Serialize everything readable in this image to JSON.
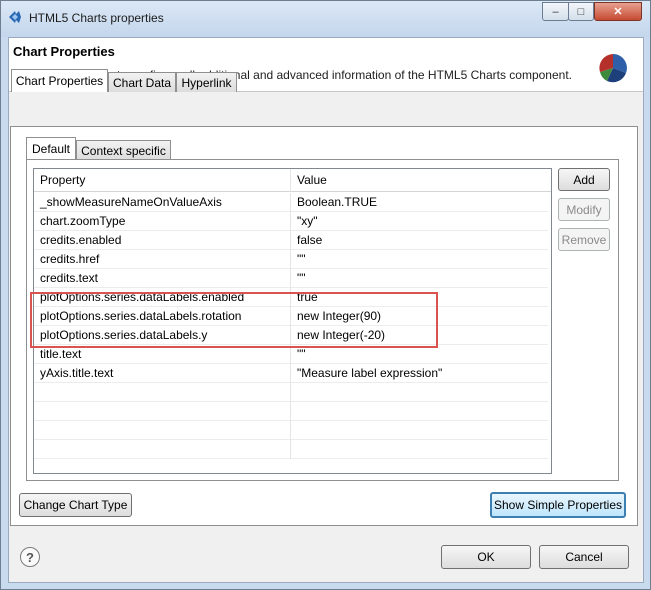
{
  "window": {
    "title": "HTML5 Charts properties",
    "controls": {
      "minimize": "–",
      "maximize": "□",
      "close": "✕"
    }
  },
  "header": {
    "title": "Chart Properties",
    "description": "The dialog allows to configure all additional and advanced information of the HTML5 Charts component.",
    "icon": "pie-chart-icon"
  },
  "tabs": [
    {
      "label": "Chart Properties",
      "active": true
    },
    {
      "label": "Chart Data",
      "active": false
    },
    {
      "label": "Hyperlink",
      "active": false
    }
  ],
  "inner_tabs": [
    {
      "label": "Default",
      "active": true
    },
    {
      "label": "Context specific",
      "active": false
    }
  ],
  "table": {
    "columns": [
      "Property",
      "Value"
    ],
    "rows": [
      {
        "property": "_showMeasureNameOnValueAxis",
        "value": "Boolean.TRUE"
      },
      {
        "property": "chart.zoomType",
        "value": "\"xy\""
      },
      {
        "property": "credits.enabled",
        "value": "false"
      },
      {
        "property": "credits.href",
        "value": "\"\""
      },
      {
        "property": "credits.text",
        "value": "\"\""
      },
      {
        "property": "plotOptions.series.dataLabels.enabled",
        "value": "true"
      },
      {
        "property": "plotOptions.series.dataLabels.rotation",
        "value": "new Integer(90)"
      },
      {
        "property": "plotOptions.series.dataLabels.y",
        "value": "new Integer(-20)"
      },
      {
        "property": "title.text",
        "value": "\"\""
      },
      {
        "property": "yAxis.title.text",
        "value": "\"Measure label expression\""
      }
    ]
  },
  "side_buttons": {
    "add": "Add",
    "modify": "Modify",
    "remove": "Remove"
  },
  "footer": {
    "change_chart_type": "Change Chart Type",
    "show_simple_properties": "Show Simple Properties",
    "ok": "OK",
    "cancel": "Cancel",
    "help": "?"
  },
  "colors": {
    "highlight": "#d9534f",
    "focus_button": "#3c7fb1"
  }
}
